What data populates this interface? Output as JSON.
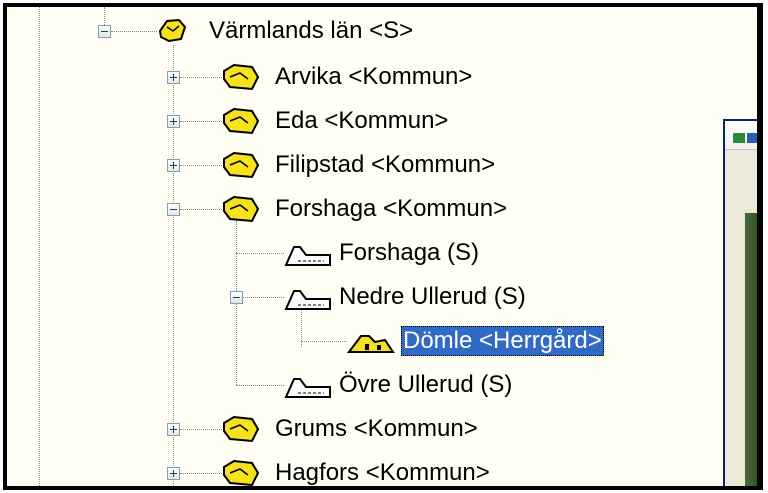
{
  "tree": {
    "root": {
      "label": "Värmlands län <S>",
      "expanded": true,
      "icon": "county-icon"
    },
    "kommuner": [
      {
        "label": "Arvika <Kommun>",
        "expanded": false,
        "icon": "municipality-icon"
      },
      {
        "label": "Eda <Kommun>",
        "expanded": false,
        "icon": "municipality-icon"
      },
      {
        "label": "Filipstad <Kommun>",
        "expanded": false,
        "icon": "municipality-icon"
      },
      {
        "label": "Forshaga <Kommun>",
        "expanded": true,
        "icon": "municipality-icon",
        "children": [
          {
            "label": "Forshaga (S)",
            "icon": "parish-icon"
          },
          {
            "label": "Nedre Ullerud (S)",
            "expanded": true,
            "icon": "parish-icon",
            "children": [
              {
                "label": "Dömle <Herrgård>",
                "icon": "manor-icon",
                "selected": true
              }
            ]
          },
          {
            "label": "Övre Ullerud (S)",
            "icon": "parish-icon"
          }
        ]
      },
      {
        "label": "Grums <Kommun>",
        "expanded": false,
        "icon": "municipality-icon"
      },
      {
        "label": "Hagfors <Kommun>",
        "expanded": false,
        "icon": "municipality-icon"
      }
    ]
  },
  "colors": {
    "tree_background": "#fffff4",
    "selection": "#316ac5",
    "icon_yellow": "#f5e21c"
  }
}
